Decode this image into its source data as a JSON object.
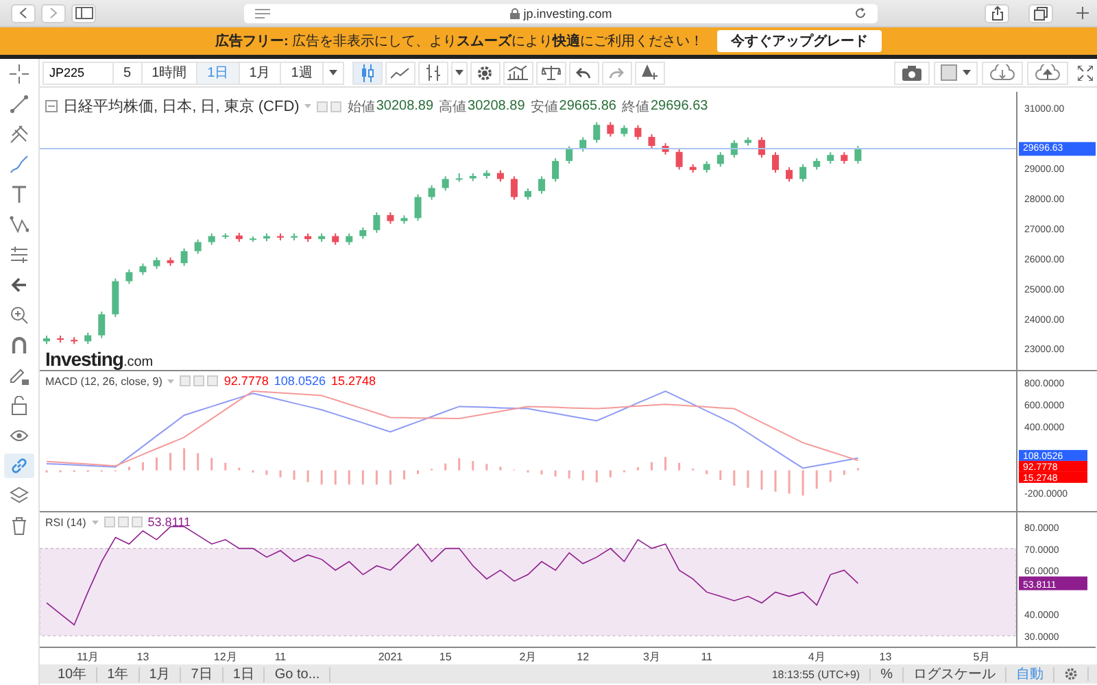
{
  "browser": {
    "url": "jp.investing.com"
  },
  "banner": {
    "text": "**広告フリー:** 広告を非表示にして、より**スムーズ**により**快適**にご利用ください！",
    "button": "今すぐアップグレード"
  },
  "toolbar": {
    "symbol": "JP225",
    "intervals": [
      {
        "label": "5",
        "selected": false
      },
      {
        "label": "1時間",
        "selected": false
      },
      {
        "label": "1日",
        "selected": true
      },
      {
        "label": "1月",
        "selected": false
      },
      {
        "label": "1週",
        "selected": false
      }
    ],
    "tools": [
      {
        "kind": "candles",
        "selected": true
      },
      {
        "kind": "line",
        "selected": false
      },
      {
        "kind": "bars",
        "selected": false
      },
      {
        "kind": "caret",
        "selected": false
      },
      {
        "kind": "gear",
        "selected": false
      },
      {
        "kind": "indicators",
        "selected": false
      },
      {
        "kind": "scales",
        "selected": false
      },
      {
        "kind": "undo",
        "selected": false
      },
      {
        "kind": "redo",
        "selected": false
      },
      {
        "kind": "alert",
        "selected": false
      }
    ],
    "right_tools": [
      {
        "kind": "camera"
      },
      {
        "kind": "swatch"
      },
      {
        "kind": "cloud-down"
      },
      {
        "kind": "cloud-up"
      },
      {
        "kind": "fullscreen"
      }
    ]
  },
  "left_tools": [
    {
      "kind": "crosshair",
      "selected": false
    },
    {
      "kind": "trendline",
      "selected": false
    },
    {
      "kind": "pitchfork",
      "selected": false
    },
    {
      "kind": "brush",
      "selected": false
    },
    {
      "kind": "text",
      "selected": false
    },
    {
      "kind": "pattern",
      "selected": false
    },
    {
      "kind": "measure",
      "selected": false
    },
    {
      "kind": "back",
      "selected": false
    },
    {
      "kind": "zoom",
      "selected": false
    },
    {
      "kind": "magnet",
      "selected": false
    },
    {
      "kind": "pencil-lock",
      "selected": false
    },
    {
      "kind": "lock",
      "selected": false
    },
    {
      "kind": "eye",
      "selected": false
    },
    {
      "kind": "link",
      "selected": true
    },
    {
      "kind": "layers",
      "selected": false
    },
    {
      "kind": "trash",
      "selected": false
    }
  ],
  "legend": {
    "title": "日経平均株価, 日本, 日, 東京 (CFD)",
    "values": [
      {
        "label": "始値",
        "value": "30208.89"
      },
      {
        "label": "高値",
        "value": "30208.89"
      },
      {
        "label": "安値",
        "value": "29665.86"
      },
      {
        "label": "終値",
        "value": "29696.63"
      }
    ]
  },
  "logo": {
    "name": "Investing",
    "suffix": ".com"
  },
  "price_panel": {
    "tag": "29696.63",
    "chart_data": {
      "type": "candlestick",
      "ylim": [
        22350,
        31600
      ],
      "yticks": [
        {
          "value": 31000,
          "label": "31000.00"
        },
        {
          "value": 29000,
          "label": "29000.00"
        },
        {
          "value": 28000,
          "label": "28000.00"
        },
        {
          "value": 27000,
          "label": "27000.00"
        },
        {
          "value": 26000,
          "label": "26000.00"
        },
        {
          "value": 25000,
          "label": "25000.00"
        },
        {
          "value": 24000,
          "label": "24000.00"
        },
        {
          "value": 23000,
          "label": "23000.00"
        }
      ],
      "categories": [
        null,
        null,
        null,
        null,
        null,
        null,
        null,
        null,
        null,
        null,
        null,
        null,
        null,
        null,
        null,
        null,
        null,
        null,
        null,
        null,
        null,
        null,
        null,
        null,
        null,
        null,
        null,
        null,
        null,
        null,
        null,
        null,
        null,
        null,
        null,
        null,
        null,
        null,
        null,
        null,
        null,
        null,
        null,
        null,
        null,
        null,
        null,
        null,
        null,
        null,
        null,
        null,
        null,
        null,
        null,
        null,
        null,
        null,
        null,
        null,
        null,
        null,
        null,
        null,
        null,
        null,
        null,
        null,
        null,
        null,
        null
      ],
      "ohlc": [
        [
          23300,
          23490,
          23210,
          23400
        ],
        [
          23400,
          23490,
          23260,
          23350
        ],
        [
          23350,
          23440,
          23210,
          23300
        ],
        [
          23300,
          23590,
          23210,
          23500
        ],
        [
          23500,
          24290,
          23410,
          24200
        ],
        [
          24200,
          25390,
          24110,
          25300
        ],
        [
          25300,
          25690,
          25210,
          25600
        ],
        [
          25600,
          25890,
          25510,
          25800
        ],
        [
          25800,
          26090,
          25710,
          26000
        ],
        [
          26000,
          26090,
          25810,
          25900
        ],
        [
          25900,
          26390,
          25810,
          26300
        ],
        [
          26300,
          26690,
          26210,
          26600
        ],
        [
          26600,
          26890,
          26510,
          26800
        ],
        [
          26800,
          26890,
          26710,
          26820
        ],
        [
          26820,
          26910,
          26610,
          26700
        ],
        [
          26700,
          26790,
          26610,
          26720
        ],
        [
          26720,
          26890,
          26630,
          26800
        ],
        [
          26800,
          26890,
          26660,
          26750
        ],
        [
          26750,
          26890,
          26660,
          26800
        ],
        [
          26800,
          26890,
          26610,
          26700
        ],
        [
          26700,
          26890,
          26610,
          26800
        ],
        [
          26800,
          26890,
          26510,
          26600
        ],
        [
          26600,
          26890,
          26510,
          26800
        ],
        [
          26800,
          27090,
          26710,
          27000
        ],
        [
          27000,
          27590,
          26910,
          27500
        ],
        [
          27500,
          27590,
          27210,
          27300
        ],
        [
          27300,
          27490,
          27210,
          27400
        ],
        [
          27400,
          28190,
          27310,
          28100
        ],
        [
          28100,
          28490,
          28010,
          28400
        ],
        [
          28400,
          28790,
          28310,
          28700
        ],
        [
          28700,
          28890,
          28610,
          28720
        ],
        [
          28720,
          28890,
          28630,
          28800
        ],
        [
          28800,
          28990,
          28710,
          28900
        ],
        [
          28900,
          28990,
          28610,
          28700
        ],
        [
          28700,
          28790,
          28010,
          28100
        ],
        [
          28100,
          28390,
          28010,
          28300
        ],
        [
          28300,
          28790,
          28210,
          28700
        ],
        [
          28700,
          29390,
          28610,
          29300
        ],
        [
          29300,
          29790,
          29210,
          29700
        ],
        [
          29700,
          30090,
          29610,
          30000
        ],
        [
          30000,
          30590,
          29910,
          30500
        ],
        [
          30500,
          30590,
          30110,
          30200
        ],
        [
          30200,
          30490,
          30110,
          30400
        ],
        [
          30400,
          30490,
          30010,
          30100
        ],
        [
          30100,
          30190,
          29710,
          29800
        ],
        [
          29800,
          29890,
          29510,
          29600
        ],
        [
          29600,
          29690,
          29010,
          29100
        ],
        [
          29100,
          29190,
          28910,
          29000
        ],
        [
          29000,
          29290,
          28910,
          29200
        ],
        [
          29200,
          29590,
          29110,
          29500
        ],
        [
          29500,
          29990,
          29410,
          29900
        ],
        [
          29900,
          30090,
          29810,
          30000
        ],
        [
          30000,
          30090,
          29410,
          29500
        ],
        [
          29500,
          29590,
          28910,
          29000
        ],
        [
          29000,
          29090,
          28610,
          28700
        ],
        [
          28700,
          29190,
          28610,
          29100
        ],
        [
          29100,
          29390,
          29010,
          29300
        ],
        [
          29300,
          29590,
          29210,
          29500
        ],
        [
          29500,
          29590,
          29210,
          29300
        ],
        [
          29300,
          29800,
          29210,
          29700
        ],
        null,
        null,
        null,
        null,
        null,
        null,
        null,
        null,
        null,
        null,
        null
      ]
    }
  },
  "macd_panel": {
    "label": "MACD (12, 26, close, 9)",
    "values": [
      {
        "text": "92.7778",
        "color": "#ff0000"
      },
      {
        "text": "108.0526",
        "color": "#2962ff"
      },
      {
        "text": "15.2748",
        "color": "#ff0000"
      }
    ],
    "tags": [
      {
        "text": "108.0526",
        "color": "#2962ff"
      },
      {
        "text": "92.7778",
        "color": "#ff0000"
      },
      {
        "text": "15.2748",
        "color": "#ff0000"
      }
    ],
    "chart_data": {
      "type": "line",
      "ylim": [
        -370,
        900
      ],
      "categories": [
        null,
        null,
        null,
        null,
        null,
        null,
        null,
        null,
        null,
        null,
        null,
        null,
        null,
        null,
        null,
        null,
        null,
        null,
        null,
        null,
        null,
        null,
        null,
        null,
        null,
        null,
        null,
        null,
        null,
        null,
        null,
        null,
        null,
        null,
        null,
        null,
        null,
        null,
        null,
        null,
        null,
        null,
        null,
        null,
        null,
        null,
        null,
        null,
        null,
        null,
        null,
        null,
        null,
        null,
        null,
        null,
        null,
        null,
        null,
        null,
        null,
        null,
        null,
        null,
        null,
        null,
        null,
        null,
        null,
        null,
        null
      ],
      "yticks": [
        {
          "value": 800,
          "label": "800.0000"
        },
        {
          "value": 600,
          "label": "600.0000"
        },
        {
          "value": 400,
          "label": "400.0000"
        },
        {
          "value": -200,
          "label": "-200.0000"
        }
      ],
      "series": [
        {
          "color": "#8f9cf5",
          "values": [
            60,
            54,
            48,
            42,
            36,
            30,
            124,
            218,
            312,
            406,
            500,
            540,
            580,
            620,
            660,
            700,
            670,
            640,
            610,
            580,
            550,
            510,
            470,
            430,
            390,
            350,
            396,
            442,
            488,
            534,
            580,
            576,
            572,
            568,
            564,
            560,
            538,
            516,
            494,
            472,
            450,
            504,
            558,
            612,
            666,
            720,
            660,
            600,
            540,
            480,
            420,
            340,
            260,
            180,
            100,
            20,
            42,
            65,
            88,
            110,
            null,
            null,
            null,
            null,
            null,
            null,
            null,
            null,
            null,
            null,
            null
          ]
        },
        {
          "color": "#f59a9a",
          "values": [
            80,
            72,
            64,
            56,
            48,
            40,
            92,
            144,
            196,
            248,
            300,
            384,
            468,
            552,
            636,
            720,
            712,
            704,
            696,
            688,
            680,
            640,
            600,
            560,
            520,
            480,
            478,
            476,
            474,
            472,
            470,
            492,
            514,
            536,
            558,
            580,
            576,
            572,
            568,
            564,
            560,
            568,
            576,
            584,
            592,
            600,
            592,
            584,
            576,
            568,
            560,
            498,
            436,
            374,
            312,
            250,
            210,
            170,
            130,
            90,
            null,
            null,
            null,
            null,
            null,
            null,
            null,
            null,
            null,
            null,
            null
          ]
        }
      ]
    }
  },
  "rsi_panel": {
    "label": "RSI (14)",
    "value": {
      "text": "53.8111",
      "color": "#8e1e8e"
    },
    "tag": {
      "text": "53.8111",
      "color": "#8e1e8e"
    },
    "chart_data": {
      "type": "line",
      "ylim": [
        25,
        86.5
      ],
      "categories": [
        null,
        null,
        null,
        "11月",
        null,
        null,
        null,
        "13",
        null,
        null,
        null,
        null,
        null,
        "12月",
        null,
        null,
        null,
        "11",
        null,
        null,
        null,
        null,
        null,
        null,
        null,
        "2021",
        null,
        null,
        null,
        "15",
        null,
        null,
        null,
        null,
        null,
        "2月",
        null,
        null,
        null,
        "12",
        null,
        null,
        null,
        null,
        "3月",
        null,
        null,
        null,
        "11",
        null,
        null,
        null,
        null,
        null,
        null,
        null,
        "4月",
        null,
        null,
        null,
        null,
        "13",
        null,
        null,
        null,
        null,
        null,
        null,
        "5月",
        null,
        null
      ],
      "yticks": [
        {
          "value": 80,
          "label": "80.0000"
        },
        {
          "value": 70,
          "label": "70.0000"
        },
        {
          "value": 60,
          "label": "60.0000"
        },
        {
          "value": 40,
          "label": "40.0000"
        },
        {
          "value": 30,
          "label": "30.0000"
        }
      ],
      "series": [
        {
          "color": "#8e1e8e",
          "values": [
            45,
            40,
            35,
            50,
            64,
            75,
            72,
            78,
            74,
            80,
            80,
            76,
            72,
            74,
            70,
            70,
            66,
            69,
            64,
            67,
            65,
            60,
            64,
            58,
            62,
            60,
            66,
            72,
            64,
            70,
            70,
            62,
            56,
            60,
            55,
            58,
            64,
            60,
            68,
            63,
            66,
            70,
            64,
            74,
            70,
            72,
            60,
            56,
            50,
            48,
            46,
            48,
            45,
            50,
            48,
            50,
            44,
            58,
            60,
            54,
            null,
            null,
            null,
            null,
            null,
            null,
            null,
            null,
            null,
            null,
            null
          ]
        }
      ]
    }
  },
  "bottom_bar": {
    "ranges": [
      "10年",
      "1年",
      "1月",
      "7日",
      "1日",
      "Go to..."
    ],
    "time": "18:13:55 (UTC+9)",
    "options": [
      {
        "label": "%",
        "selected": false
      },
      {
        "label": "ログスケール",
        "selected": false
      },
      {
        "label": "自動",
        "selected": true
      }
    ]
  }
}
